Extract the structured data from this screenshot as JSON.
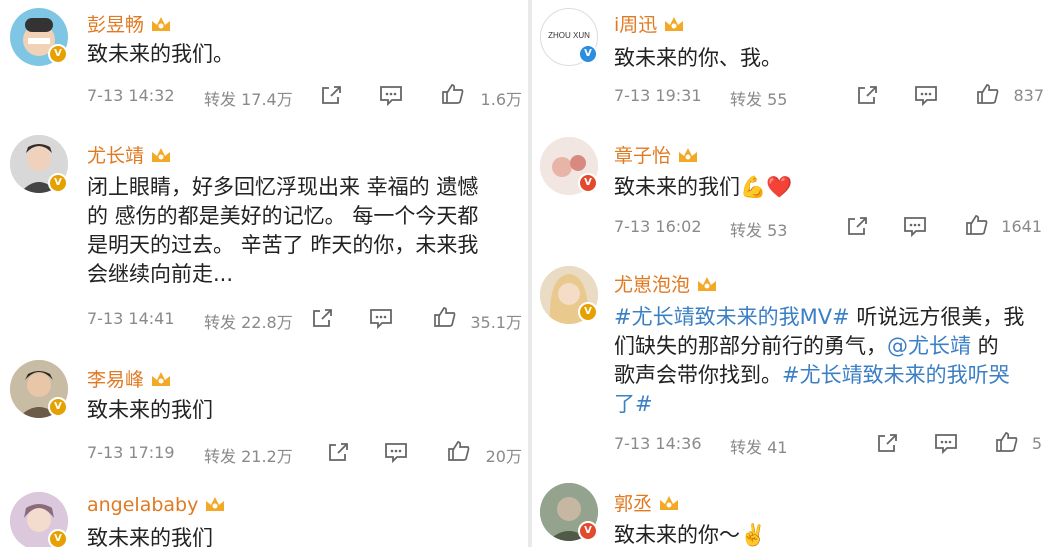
{
  "left": [
    {
      "name": "彭昱畅",
      "text": "致未来的我们。",
      "time": "7-13 14:32",
      "repost": "转发 17.4万",
      "likes": "1.6万"
    },
    {
      "name": "尤长靖",
      "text": "闭上眼睛，好多回忆浮现出来 幸福的 遗憾\n的 感伤的都是美好的记忆。 每一个今天都\n是明天的过去。 辛苦了 昨天的你，未来我\n会继续向前走...",
      "time": "7-13 14:41",
      "repost": "转发 22.8万",
      "likes": "35.1万"
    },
    {
      "name": "李易峰",
      "text": "致未来的我们",
      "time": "7-13 17:19",
      "repost": "转发 21.2万",
      "likes": "20万"
    },
    {
      "name": "angelababy",
      "text": "致未来的我们",
      "time": "",
      "repost": "",
      "likes": ""
    }
  ],
  "right": [
    {
      "name": "i周迅",
      "avatar_text": "ZHOU XUN",
      "text": "致未来的你、我。",
      "time": "7-13 19:31",
      "repost": "转发 55",
      "likes": "837"
    },
    {
      "name": "章子怡",
      "text": "致未来的我们💪❤️",
      "time": "7-13 16:02",
      "repost": "转发 53",
      "likes": "1641"
    },
    {
      "name": "尤崽泡泡",
      "text_tag1": "#尤长靖致未来的我MV#",
      "text_mid1": " 听说远方很美，我\n们缺失的那部分前行的勇气，",
      "text_tag2": "@尤长靖",
      "text_mid2": " 的\n歌声会带你找到。",
      "text_tag3": "#尤长靖致未来的我听哭\n了#",
      "time": "7-13 14:36",
      "repost": "转发 41",
      "likes": "5"
    },
    {
      "name": "郭丞",
      "text": "致未来的你～✌️",
      "time": "",
      "repost": "",
      "likes": ""
    }
  ],
  "badges": {
    "verified": "V"
  },
  "colors": {
    "name": "#e07a22",
    "link": "#3b7fc4",
    "meta": "#8a8a8a"
  }
}
